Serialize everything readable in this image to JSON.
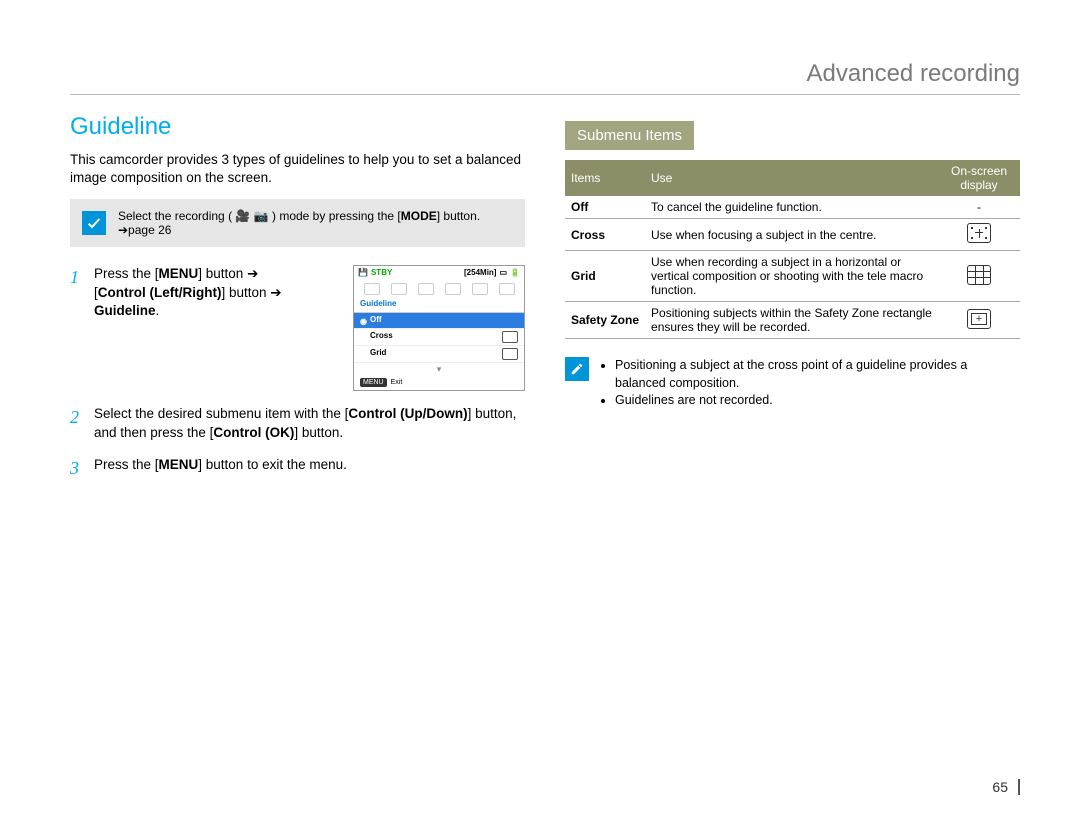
{
  "chapter_title": "Advanced recording",
  "section_title": "Guideline",
  "intro": "This camcorder provides 3 types of guidelines to help you to set a balanced image composition on the screen.",
  "prenote": {
    "text_before": "Select the recording (",
    "text_after": ") mode by pressing the [",
    "mode_label": "MODE",
    "tail": "] button. ➔page 26"
  },
  "steps": [
    {
      "num": "1",
      "parts": {
        "a": "Press the [",
        "menu": "MENU",
        "b": "] button ➔ [",
        "ctrl1": "Control (Left/Right)",
        "c": "] button ➔ ",
        "guideline": "Guideline",
        "d": "."
      }
    },
    {
      "num": "2",
      "parts": {
        "a": "Select the desired submenu item with the [",
        "ctrl2": "Control (Up/Down)",
        "b": "] button, and then press the [",
        "ctrlok": "Control (OK)",
        "c": "] button."
      }
    },
    {
      "num": "3",
      "parts": {
        "a": "Press the [",
        "menu": "MENU",
        "b": "] button to exit the menu."
      }
    }
  ],
  "lcd": {
    "stby": "STBY",
    "time_remain": "[254Min]",
    "title": "Guideline",
    "options": [
      "Off",
      "Cross",
      "Grid"
    ],
    "selected": "Off",
    "exit_badge": "MENU",
    "exit_text": "Exit"
  },
  "submenu_heading": "Submenu Items",
  "table": {
    "headers": [
      "Items",
      "Use",
      "On-screen display"
    ],
    "rows": [
      {
        "item": "Off",
        "use": "To cancel the guideline function.",
        "icon": "none",
        "dash": "-"
      },
      {
        "item": "Cross",
        "use": "Use when focusing a subject in the centre.",
        "icon": "cross"
      },
      {
        "item": "Grid",
        "use": "Use when recording a subject in a horizontal or vertical composition or shooting with the tele macro function.",
        "icon": "grid"
      },
      {
        "item": "Safety Zone",
        "use": "Positioning subjects within the Safety Zone rectangle ensures they will be recorded.",
        "icon": "safety"
      }
    ]
  },
  "notes": [
    "Positioning a subject at the cross point of a guideline provides a balanced composition.",
    "Guidelines are not recorded."
  ],
  "page_number": "65"
}
